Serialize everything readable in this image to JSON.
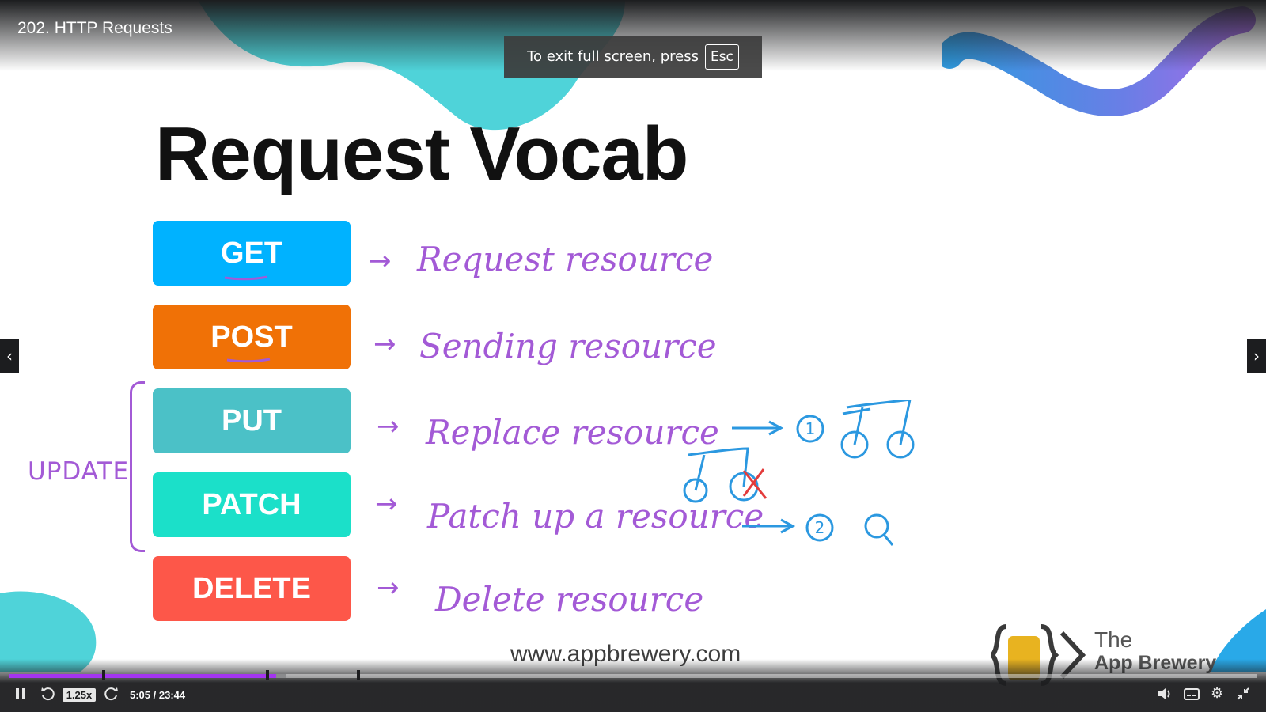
{
  "video": {
    "title": "202. HTTP Requests"
  },
  "fullscreen_notice": {
    "text": "To exit full screen, press",
    "key": "Esc"
  },
  "slide": {
    "title": "Request Vocab",
    "methods": [
      {
        "label": "GET",
        "color": "#00b2ff",
        "note": "Request resource"
      },
      {
        "label": "POST",
        "color": "#f07106",
        "note": "Sending resource"
      },
      {
        "label": "PUT",
        "color": "#4bc1c7",
        "note": "Replace resource"
      },
      {
        "label": "PATCH",
        "color": "#1be0c9",
        "note": "Patch up a resource"
      },
      {
        "label": "DELETE",
        "color": "#fd5749",
        "note": "Delete resource"
      }
    ],
    "update_label": "UPDATE",
    "diagram_marks": [
      "1",
      "2"
    ],
    "website": "www.appbrewery.com",
    "brand": {
      "the": "The",
      "name": "App Brewery"
    }
  },
  "player": {
    "speed": "1.25x",
    "time": "5:05 / 23:44",
    "progress_fraction": 0.214,
    "buffered_fraction": 0.222,
    "chapter_marks_fraction": [
      0.075,
      0.206,
      0.279
    ],
    "accent": "#a435f0",
    "icons": [
      "pause-icon",
      "rewind-icon",
      "forward-icon",
      "volume-icon",
      "captions-icon",
      "settings-icon",
      "exit-fullscreen-icon"
    ]
  }
}
